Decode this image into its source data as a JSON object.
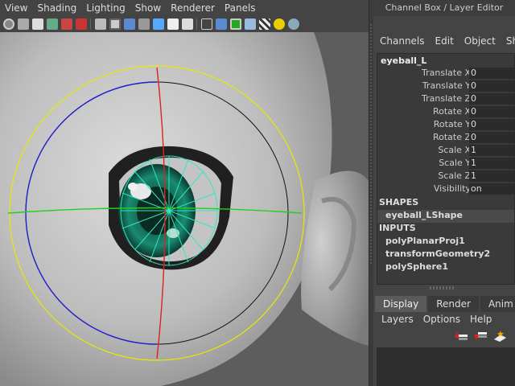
{
  "viewport": {
    "menus": [
      "View",
      "Shading",
      "Lighting",
      "Show",
      "Renderer",
      "Panels"
    ]
  },
  "panel": {
    "title": "Channel Box / Layer Editor",
    "menus": [
      "Channels",
      "Edit",
      "Object",
      "Show"
    ],
    "object_name": "eyeball_L",
    "attributes": [
      {
        "label": "Translate X",
        "value": "0"
      },
      {
        "label": "Translate Y",
        "value": "0"
      },
      {
        "label": "Translate Z",
        "value": "0"
      },
      {
        "label": "Rotate X",
        "value": "0"
      },
      {
        "label": "Rotate Y",
        "value": "0"
      },
      {
        "label": "Rotate Z",
        "value": "0"
      },
      {
        "label": "Scale X",
        "value": "1"
      },
      {
        "label": "Scale Y",
        "value": "1"
      },
      {
        "label": "Scale Z",
        "value": "1"
      },
      {
        "label": "Visibility",
        "value": "on"
      }
    ],
    "shapes_header": "SHAPES",
    "shapes": [
      "eyeball_LShape"
    ],
    "inputs_header": "INPUTS",
    "inputs": [
      "polyPlanarProj1",
      "transformGeometry2",
      "polySphere1"
    ],
    "tabs": [
      "Display",
      "Render",
      "Anim"
    ],
    "layer_menus": [
      "Layers",
      "Options",
      "Help"
    ]
  },
  "colors": {
    "accent_yellow": "#e8e800",
    "axis_red": "#e02020",
    "axis_green": "#20d020",
    "axis_blue": "#2020d0",
    "iris_teal": "#1a7a64"
  }
}
